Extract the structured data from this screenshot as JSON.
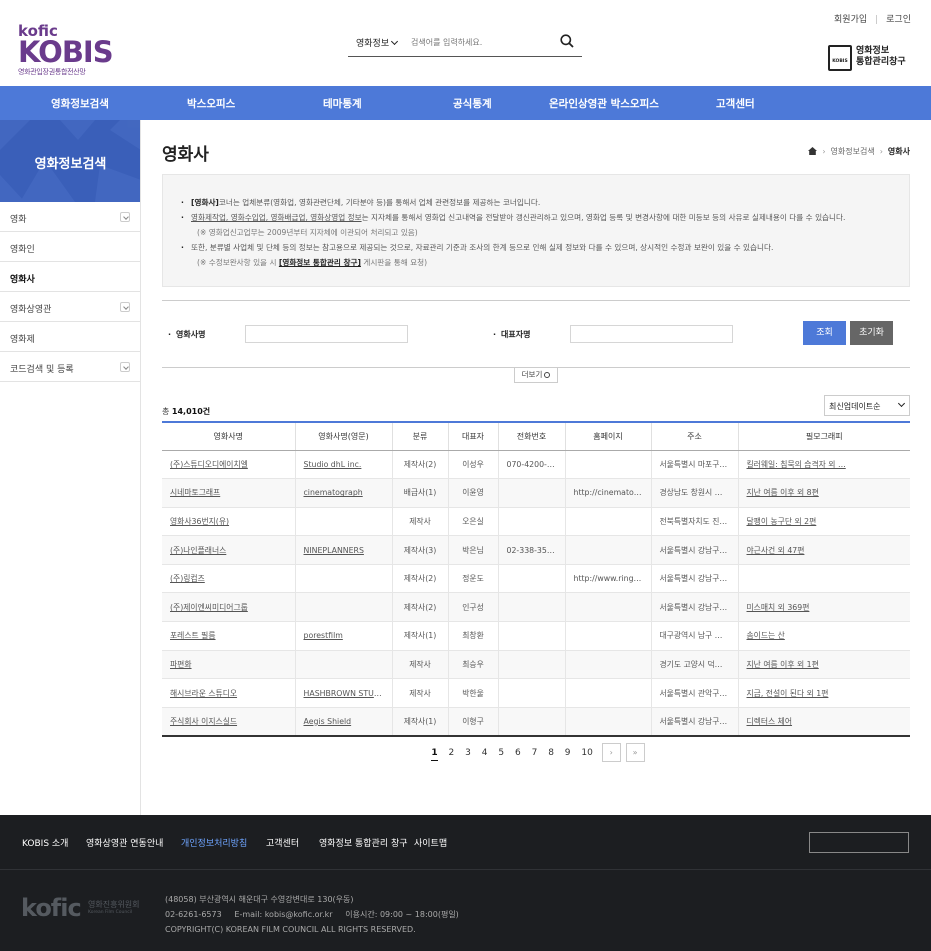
{
  "header": {
    "logo_kofic": "kofic",
    "logo_kobis": "KOBIS",
    "logo_sub": "영화관입장권통합전산망",
    "search_select": "영화정보",
    "search_placeholder": "검색어를 입력하세요.",
    "util_join": "회원가입",
    "util_login": "로그인",
    "portal_tag": "KOBIS",
    "portal_line1": "영화정보",
    "portal_line2": "통합관리창구"
  },
  "gnb": [
    "영화정보검색",
    "박스오피스",
    "테마통계",
    "공식통계",
    "온라인상영관 박스오피스",
    "고객센터"
  ],
  "lnb": {
    "title": "영화정보검색",
    "items": [
      {
        "label": "영화",
        "toggle": true
      },
      {
        "label": "영화인",
        "toggle": false
      },
      {
        "label": "영화사",
        "toggle": false,
        "active": true
      },
      {
        "label": "영화상영관",
        "toggle": true
      },
      {
        "label": "영화제",
        "toggle": false
      },
      {
        "label": "코드검색 및 등록",
        "toggle": true
      }
    ]
  },
  "page": {
    "title": "영화사",
    "breadcrumb": [
      "영화정보검색",
      "영화사"
    ]
  },
  "notice": {
    "l1_b": "[영화사]",
    "l1_t": "코너는 업체분류(영화업, 영화관련단체, 기타분야 등)를 통해서 업체 관련정보를 제공하는 코너입니다.",
    "l2_u": "영화제작업, 영화수입업, 영화배급업, 영화상영업 정보",
    "l2_t": "는 지자체를 통해서 영화업 신고내역을 전달받아 갱신관리하고 있으며, 영화업 등록 및 변경사항에 대한 미등보 등의 사유로 실제내용이 다를 수 있습니다.",
    "l3": "(※ 영화업신고업무는 2009년부터 지자체에 이관되어 처리되고 있음)",
    "l4": "또한, 분류별 사업체 및 단체 등의 정보는 참고용으로 제공되는 것으로, 자료관리 기준과 조사의 한계 등으로 인해 실제 정보와 다를 수 있으며, 상시적인 수정과 보완이 있을 수 있습니다.",
    "l5_a": "(※ 수정보완사항 있을 시 ",
    "l5_b": "[영화정보 통합관리 창구]",
    "l5_c": " 게시판을 통해 요청)"
  },
  "form": {
    "company_label": "영화사명",
    "ceo_label": "대표자명",
    "search_btn": "조회",
    "reset_btn": "초기화",
    "more_btn": "더보기"
  },
  "list": {
    "total_prefix": "총 ",
    "total_count": "14,010건",
    "sort": "최신업데이트순",
    "columns": [
      "영화사명",
      "영화사명(영문)",
      "분류",
      "대표자",
      "전화번호",
      "홈페이지",
      "주소",
      "필모그래피"
    ],
    "rows": [
      [
        "(주)스튜디오디에이치엘",
        "Studio dhL inc.",
        "제작사(2)",
        "이성우",
        "070-4200-4…",
        "",
        "서울특별시 마포구…",
        "킬러웨일: 침묵의 습격자 외 …"
      ],
      [
        "시네마토그래프",
        "cinematograph",
        "배급사(1)",
        "이윤영",
        "",
        "http://cinematog…",
        "경상남도 창원시 …",
        "지난 여름 이후 외 8편"
      ],
      [
        "영화사36번지(유)",
        "",
        "제작사",
        "오은실",
        "",
        "",
        "전북특별자치도 진…",
        "달팽이 농구단 외 2편"
      ],
      [
        "(주)나인플래너스",
        "NINEPLANNERS",
        "제작사(3)",
        "박은님",
        "02-338-3577",
        "",
        "서울특별시 강남구…",
        "야근사건 외 47편"
      ],
      [
        "(주)링컴즈",
        "",
        "제작사(2)",
        "정운도",
        "",
        "http://www.ringc…",
        "서울특별시 강남구…",
        ""
      ],
      [
        "(주)제이엔씨미디어그룹",
        "",
        "제작사(2)",
        "인구성",
        "",
        "",
        "서울특별시 강남구…",
        "미스매치 외 369편"
      ],
      [
        "포레스트 필름",
        "porestfilm",
        "제작사(1)",
        "최창환",
        "",
        "",
        "대구광역시 남구 …",
        "솜이드는 산"
      ],
      [
        "파편화",
        "",
        "제작사",
        "최승우",
        "",
        "",
        "경기도 고양시 덕…",
        "지난 여름 이후 외 1편"
      ],
      [
        "해시브라운 스튜디오",
        "HASHBROWN STUDIO",
        "제작사",
        "박한울",
        "",
        "",
        "서울특별시 관악구…",
        "지금, 전설이 된다 외 1편"
      ],
      [
        "주식회사 이지스실드",
        "Aegis Shield",
        "제작사(1)",
        "이형구",
        "",
        "",
        "서울특별시 강남구…",
        "디렉터스 체어"
      ]
    ]
  },
  "paging": [
    "1",
    "2",
    "3",
    "4",
    "5",
    "6",
    "7",
    "8",
    "9",
    "10"
  ],
  "paging_next": "›",
  "paging_last": "»",
  "footer": {
    "links": [
      "KOBIS 소개",
      "영화상영관 연동안내",
      "개인정보처리방침",
      "고객센터",
      "영화정보 통합관리 창구",
      "사이트맵"
    ],
    "logo": "kofic",
    "logo_kr": "영화진흥위원회",
    "logo_en": "Korean Film Council",
    "addr": "(48058) 부산광역시 해운대구 수영강변대로 130(우동)",
    "contact": "02-6261-6573     E-mail: kobis@kofic.or.kr     이용시간: 09:00 ~ 18:00(평일)",
    "copy": "COPYRIGHT(C) KOREAN FILM COUNCIL ALL RIGHTS RESERVED."
  },
  "colors": {
    "accent": "#4d79d8",
    "brand": "#6a3b8c",
    "footer_bg": "#1c1e21",
    "reset_btn": "#666666"
  }
}
